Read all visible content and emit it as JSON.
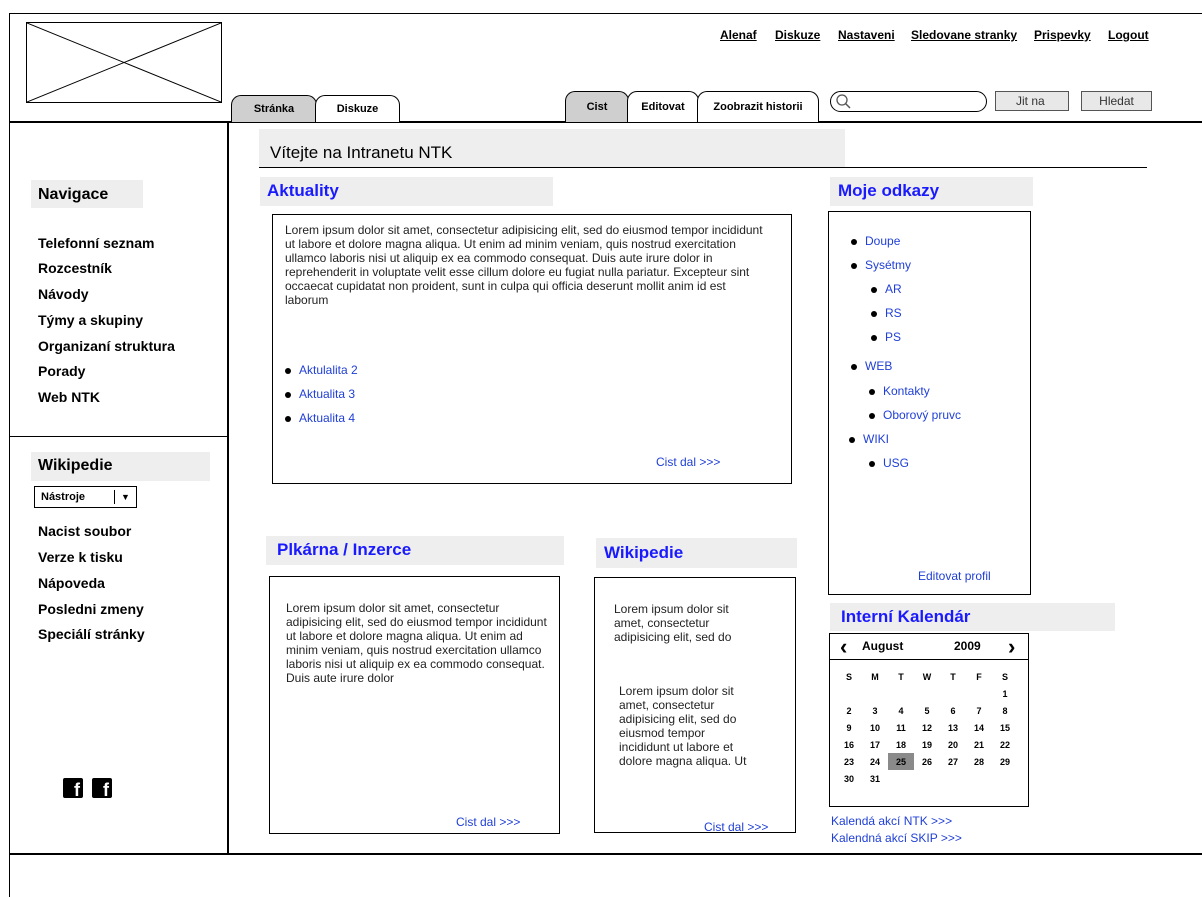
{
  "top_links": [
    "Alenaf",
    "Diskuze",
    "Nastaveni",
    "Sledovane stranky",
    "Prispevky",
    "Logout"
  ],
  "page_tabs": [
    "Stránka",
    "Diskuze"
  ],
  "view_tabs": [
    "Cist",
    "Editovat",
    "Zoobrazit historii"
  ],
  "search": {
    "go_label": "Jit na",
    "search_label": "Hledat"
  },
  "page_title": "Vítejte na Intranetu NTK",
  "navigation": {
    "title": "Navigace",
    "items": [
      "Telefonní seznam",
      "Rozcestník",
      "Návody",
      "Týmy a skupiny",
      "Organizaní struktura",
      "Porady",
      "Web NTK"
    ]
  },
  "wikipedia_sidebar": {
    "title": "Wikipedie",
    "tools_label": "Nástroje",
    "items": [
      "Nacist soubor",
      "Verze k tisku",
      "Nápoveda",
      "Posledni zmeny",
      "Speciálí stránky"
    ]
  },
  "news": {
    "title": "Aktuality",
    "text": "Lorem ipsum dolor sit amet, consectetur adipisicing elit, sed do eiusmod tempor incididunt ut labore et dolore magna aliqua. Ut enim ad minim veniam, quis nostrud exercitation ullamco laboris nisi ut aliquip ex ea commodo consequat. Duis aute irure dolor in reprehenderit in voluptate velit esse cillum dolore eu fugiat nulla pariatur. Excepteur sint occaecat cupidatat non proident, sunt in culpa qui officia deserunt mollit anim id est laborum",
    "items": [
      "Aktulalita 2",
      "Aktualita 3",
      "Aktualita 4"
    ],
    "more": "Cist dal >>>"
  },
  "ads": {
    "title": "Plkárna / Inzerce",
    "text": "Lorem ipsum dolor sit amet, consectetur adipisicing elit, sed do eiusmod tempor incididunt ut labore et dolore magna aliqua. Ut enim ad minim veniam, quis nostrud exercitation ullamco laboris nisi ut aliquip ex ea commodo consequat. Duis aute irure dolor",
    "more": "Cist dal >>>"
  },
  "wiki_box": {
    "title": "Wikipedie",
    "text1": "Lorem ipsum dolor sit amet, consectetur adipisicing elit, sed do",
    "text2": "Lorem ipsum dolor sit amet, consectetur adipisicing elit, sed do eiusmod tempor incididunt ut labore et dolore magna aliqua. Ut",
    "more": "Cist dal >>>"
  },
  "my_links": {
    "title": "Moje odkazy",
    "l1": "Doupe",
    "l2": "Sysétmy",
    "l2_children": [
      "AR",
      "RS",
      "PS"
    ],
    "l3": "WEB",
    "l3_children": [
      "Kontakty",
      "Oborový pruvc"
    ],
    "l4": "WIKI",
    "l4_children": [
      "USG"
    ],
    "edit_profile": "Editovat profil"
  },
  "calendar": {
    "title": "Interní Kalendár",
    "prev": "‹",
    "next": "›",
    "month": "August",
    "year": "2009",
    "weekdays": [
      "S",
      "M",
      "T",
      "W",
      "T",
      "F",
      "S"
    ],
    "weeks": [
      [
        "",
        "",
        "",
        "",
        "",
        "",
        "1"
      ],
      [
        "2",
        "3",
        "4",
        "5",
        "6",
        "7",
        "8"
      ],
      [
        "9",
        "10",
        "11",
        "12",
        "13",
        "14",
        "15"
      ],
      [
        "16",
        "17",
        "18",
        "19",
        "20",
        "21",
        "22"
      ],
      [
        "23",
        "24",
        "25",
        "26",
        "27",
        "28",
        "29"
      ],
      [
        "30",
        "31",
        "",
        "",
        "",
        "",
        ""
      ]
    ],
    "selected": "25",
    "links": [
      "Kalendá akcí NTK >>>",
      "Kalendná akcí SKIP >>>"
    ]
  },
  "social": {
    "icons": [
      "facebook-icon",
      "facebook-icon"
    ],
    "glyph": "f"
  }
}
